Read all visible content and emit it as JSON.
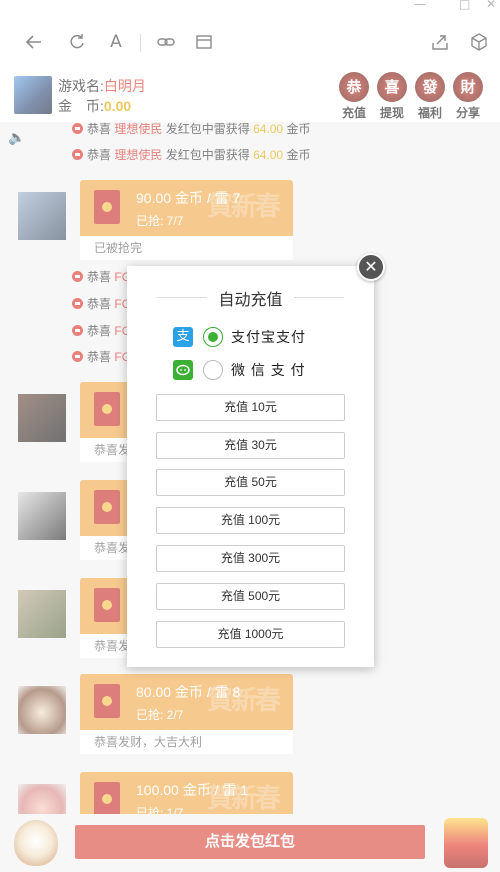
{
  "window_controls": [
    "—",
    "□",
    "✕"
  ],
  "toolbar": {
    "back_icon": "back-arrow-icon",
    "refresh_icon": "refresh-icon",
    "font_label": "A",
    "link_icon": "link-icon",
    "reader_icon": "reader-icon",
    "share_icon": "share-icon",
    "box_icon": "cube-icon"
  },
  "header": {
    "game_name_label": "游戏名:",
    "game_name_value": "白明月",
    "coins_label": "金　币:",
    "coins_value": "0.00",
    "buttons": [
      {
        "glyph": "恭",
        "label": "充值"
      },
      {
        "glyph": "喜",
        "label": "提现"
      },
      {
        "glyph": "發",
        "label": "福利"
      },
      {
        "glyph": "財",
        "label": "分享"
      }
    ]
  },
  "chat": {
    "notices_top": [
      {
        "pre": "恭喜",
        "name": "理想使民",
        "mid": "发红包中雷获得",
        "amount": "64.00",
        "post": "金币"
      },
      {
        "pre": "恭喜",
        "name": "理想使民",
        "mid": "发红包中雷获得",
        "amount": "64.00",
        "post": "金币"
      }
    ],
    "notices_mid": [
      {
        "pre": "恭喜",
        "name": "FG"
      },
      {
        "pre": "恭喜",
        "name": "FG"
      },
      {
        "pre": "恭喜",
        "name": "FG"
      },
      {
        "pre": "恭喜",
        "name": "FG"
      }
    ],
    "envelopes": [
      {
        "title": "90.00 金币 / 雷 7",
        "sub": "已抢: 7/7",
        "foot": "已被抢完",
        "deco": "賀新春"
      },
      {
        "title": "",
        "sub": "",
        "foot": "恭喜发",
        "deco": ""
      },
      {
        "title": "",
        "sub": "",
        "foot": "恭喜发",
        "deco": ""
      },
      {
        "title": "",
        "sub": "",
        "foot": "恭喜发",
        "deco": ""
      },
      {
        "title": "80.00 金币 / 雷 8",
        "sub": "已抢: 2/7",
        "foot": "恭喜发财，大吉大利",
        "deco": "賀新春"
      },
      {
        "title": "100.00 金币 / 雷 1",
        "sub": "已抢: 1/7",
        "foot": "",
        "deco": "賀新春"
      }
    ]
  },
  "bottom": {
    "send_label": "点击发包红包"
  },
  "modal": {
    "title": "自动充值",
    "close_glyph": "✕",
    "payment_methods": [
      {
        "logo": "支",
        "label": "支付宝支付",
        "selected": true
      },
      {
        "logo": "◯",
        "label": "微 信 支 付",
        "selected": false
      }
    ],
    "amount_options": [
      "充值 10元",
      "充值 30元",
      "充值 50元",
      "充值 100元",
      "充值 300元",
      "充值 500元",
      "充值 1000元"
    ]
  },
  "colors": {
    "accent_red": "#d9483a",
    "envelope_orange": "#f0a84a",
    "gold": "#e0a800",
    "alipay_blue": "#2ba1e8",
    "wechat_green": "#3cb034"
  }
}
